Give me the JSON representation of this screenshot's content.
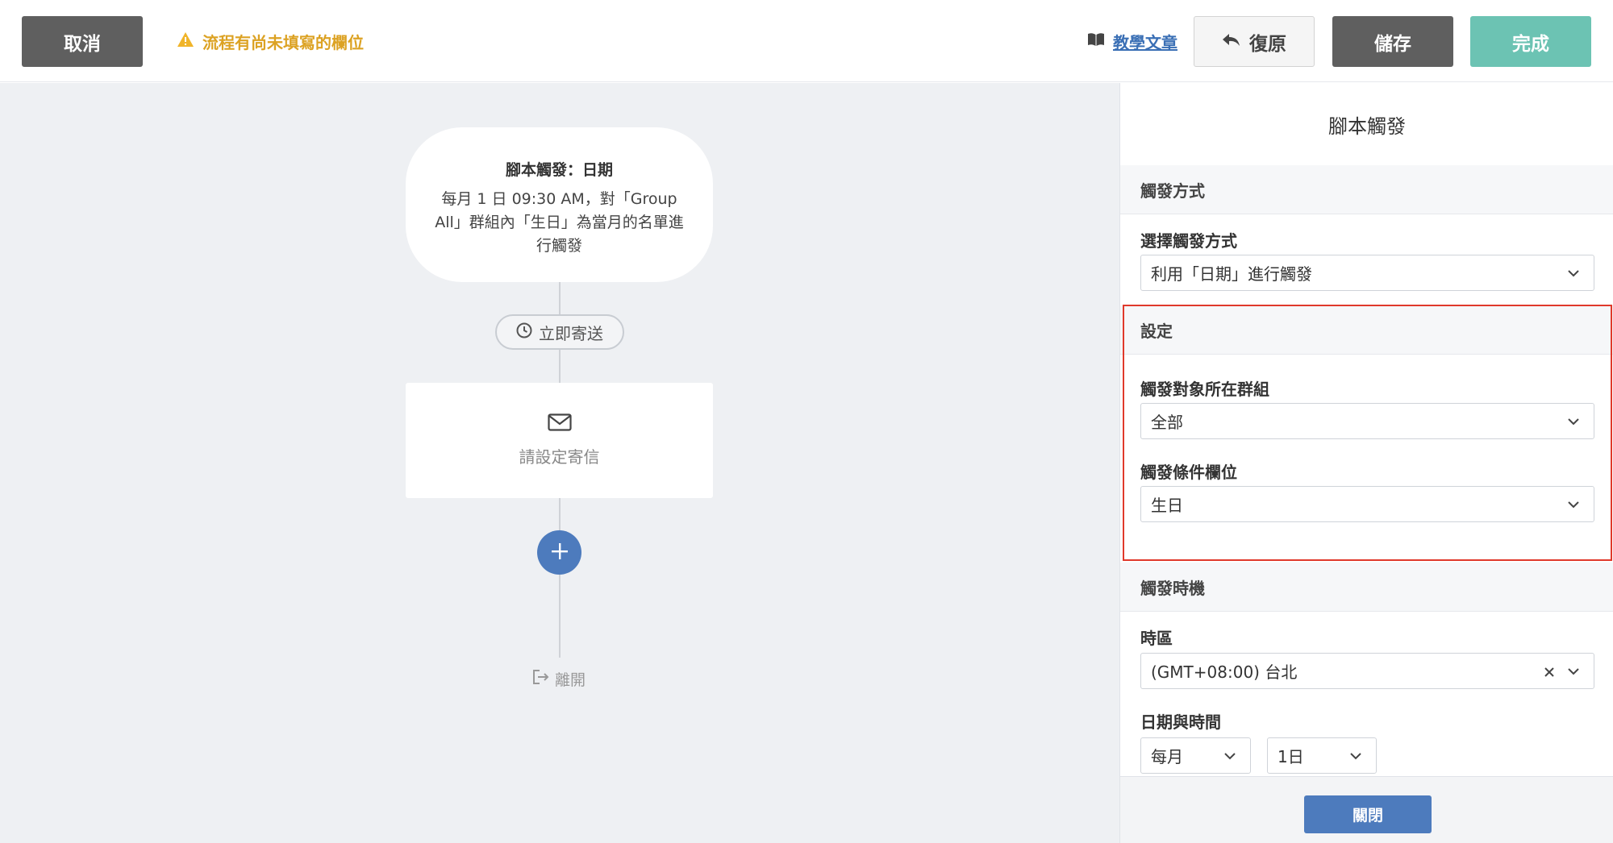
{
  "topbar": {
    "cancel_label": "取消",
    "warning_text": "流程有尚未填寫的欄位",
    "tutorial_label": "教學文章",
    "restore_label": "復原",
    "save_label": "儲存",
    "done_label": "完成"
  },
  "canvas": {
    "trigger": {
      "title": "腳本觸發：日期",
      "description": "每月 1 日 09:30 AM，對「Group All」群組內「生日」為當月的名單進行觸發"
    },
    "delay_label": "立即寄送",
    "mail_label": "請設定寄信",
    "exit_label": "離開"
  },
  "panel": {
    "title": "腳本觸發",
    "sections": {
      "trigger_method": "觸發方式",
      "settings": "設定",
      "timing": "觸發時機"
    },
    "fields": {
      "method_label": "選擇觸發方式",
      "method_value": "利用「日期」進行觸發",
      "group_label": "觸發對象所在群組",
      "group_value": "全部",
      "condition_label": "觸發條件欄位",
      "condition_value": "生日",
      "timezone_label": "時區",
      "timezone_value": "(GMT+08:00) 台北",
      "datetime_label": "日期與時間",
      "frequency_value": "每月",
      "day_value": "1日"
    },
    "close_label": "關閉"
  },
  "colors": {
    "dark_button": "#5f5f5f",
    "done_button": "#6cc3b3",
    "warning": "#dca223",
    "accent_blue": "#4d7bbd",
    "highlight_red": "#e0392b"
  }
}
